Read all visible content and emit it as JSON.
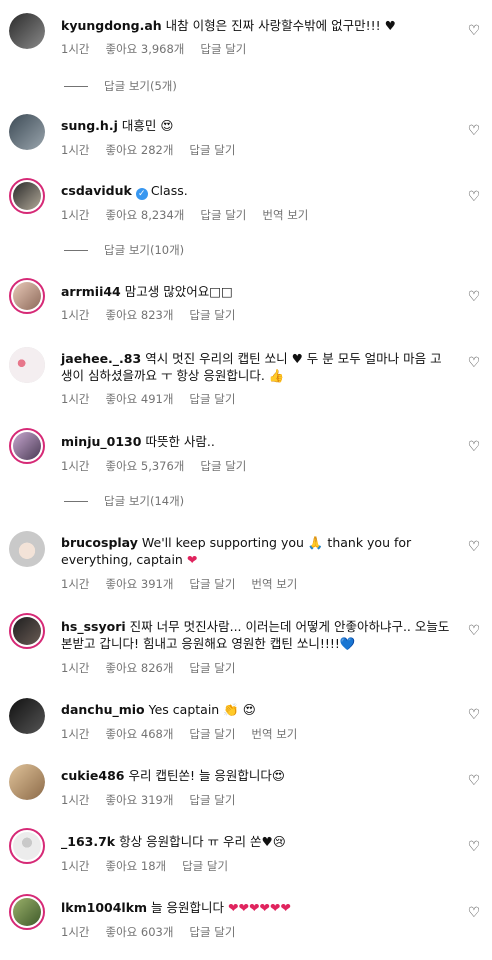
{
  "comments": [
    {
      "user": "kyungdong.ah",
      "text": "내참 이형은 진짜 사랑할수밖에 없구만!!!",
      "emoji": "♥",
      "time": "1시간",
      "likes": "좋아요 3,968개",
      "reply": "답글 달기",
      "translate": "",
      "view_replies": "답글 보기(5개)"
    },
    {
      "user": "sung.h.j",
      "text": "대흥민",
      "emoji": "😍",
      "time": "1시간",
      "likes": "좋아요 282개",
      "reply": "답글 달기",
      "translate": "",
      "view_replies": ""
    },
    {
      "user": "csdaviduk",
      "text": "Class.",
      "emoji": "",
      "time": "1시간",
      "likes": "좋아요 8,234개",
      "reply": "답글 달기",
      "translate": "번역 보기",
      "view_replies": "답글 보기(10개)"
    },
    {
      "user": "arrmii44",
      "text": "맘고생 많았어요□□",
      "emoji": "",
      "time": "1시간",
      "likes": "좋아요 823개",
      "reply": "답글 달기",
      "translate": "",
      "view_replies": ""
    },
    {
      "user": "jaehee._.83",
      "text": "역시 멋진 우리의 캡틴 쏘니 ♥ 두 분 모두 얼마나 마음 고생이 심하셨을까요 ㅜ 항상 응원합니다.",
      "emoji": "👍",
      "time": "1시간",
      "likes": "좋아요 491개",
      "reply": "답글 달기",
      "translate": "",
      "view_replies": ""
    },
    {
      "user": "minju_0130",
      "text": "따뜻한 사람..",
      "emoji": "",
      "time": "1시간",
      "likes": "좋아요 5,376개",
      "reply": "답글 달기",
      "translate": "",
      "view_replies": "답글 보기(14개)"
    },
    {
      "user": "brucosplay",
      "text": "We'll keep supporting you 🙏 thank you for everything, captain",
      "emoji": "❤",
      "time": "1시간",
      "likes": "좋아요 391개",
      "reply": "답글 달기",
      "translate": "번역 보기",
      "view_replies": ""
    },
    {
      "user": "hs_ssyori",
      "text": "진짜 너무 멋진사람... 이러는데 어떻게 안좋아하냐구.. 오늘도 본받고 갑니다! 힘내고 응원해요 영원한 캡틴 쏘니!!!!",
      "emoji": "💙",
      "time": "1시간",
      "likes": "좋아요 826개",
      "reply": "답글 달기",
      "translate": "",
      "view_replies": ""
    },
    {
      "user": "danchu_mio",
      "text": "Yes captain",
      "emoji": "👏 😍",
      "time": "1시간",
      "likes": "좋아요 468개",
      "reply": "답글 달기",
      "translate": "번역 보기",
      "view_replies": ""
    },
    {
      "user": "cukie486",
      "text": "우리 캡틴쏜! 늘 응원합니다",
      "emoji": "😍",
      "time": "1시간",
      "likes": "좋아요 319개",
      "reply": "답글 달기",
      "translate": "",
      "view_replies": ""
    },
    {
      "user": "_163.7k",
      "text": "항상 응원합니다 ㅠ 우리 쏜",
      "emoji": "♥😢",
      "time": "1시간",
      "likes": "좋아요 18개",
      "reply": "답글 달기",
      "translate": "",
      "view_replies": ""
    },
    {
      "user": "lkm1004lkm",
      "text": "늘 응원합니다",
      "emoji": "❤❤❤❤❤❤",
      "time": "1시간",
      "likes": "좋아요 603개",
      "reply": "답글 달기",
      "translate": "",
      "view_replies": ""
    }
  ],
  "colors": {
    "ring": "#d62976",
    "muted": "#737373",
    "verified": "#3897f0"
  },
  "icons": {
    "like": "heart-outline-icon",
    "verified": "verified-badge-icon"
  }
}
